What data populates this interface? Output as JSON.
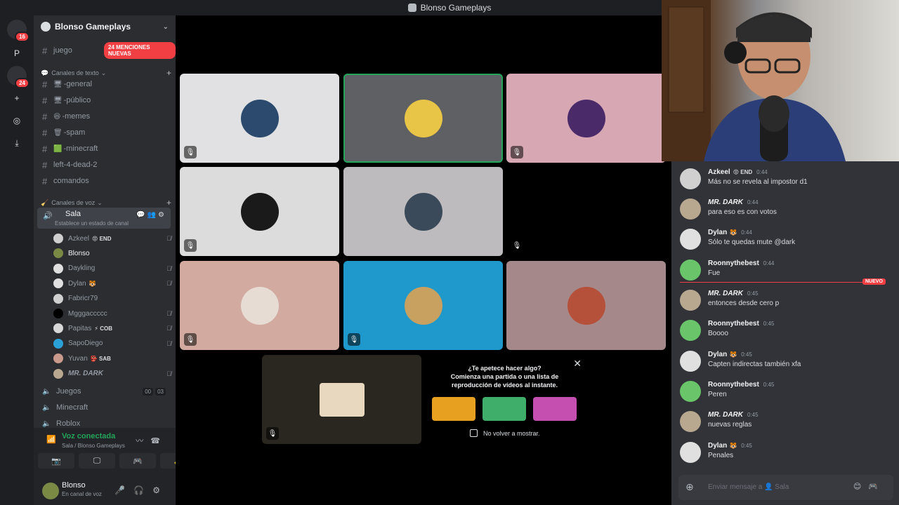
{
  "window": {
    "title": "Blonso Gameplays"
  },
  "rail": {
    "items": [
      {
        "label": "",
        "badge": "16",
        "icon": "discord-home-icon"
      },
      {
        "label": "P",
        "badge": "",
        "icon": ""
      },
      {
        "label": "",
        "badge": "24",
        "icon": "server-avatar"
      },
      {
        "label": "+",
        "badge": "",
        "icon": "add-server-icon"
      },
      {
        "label": "◎",
        "badge": "",
        "icon": "explore-icon"
      },
      {
        "label": "⤓",
        "badge": "",
        "icon": "download-icon"
      }
    ]
  },
  "server": {
    "name": "Blonso Gameplays"
  },
  "mentions_pill": "24 MENCIONES NUEVAS",
  "partial_channel": "juego",
  "text_category": "Canales de texto",
  "text_channels": [
    {
      "emoji": "🖥",
      "name": "-general"
    },
    {
      "emoji": "🖥",
      "name": "-público"
    },
    {
      "emoji": "😆",
      "name": "-memes"
    },
    {
      "emoji": "🗑",
      "name": "-spam"
    },
    {
      "emoji": "🟩",
      "name": "-minecraft"
    },
    {
      "emoji": "",
      "name": "left-4-dead-2"
    },
    {
      "emoji": "",
      "name": "comandos"
    }
  ],
  "voice_category": "Canales de voz",
  "active_voice": {
    "name": "Sala",
    "status": "Establece un estado de canal"
  },
  "voice_users": [
    {
      "name": "Azkeel",
      "tag": "😡 END",
      "muted": true,
      "color": "#cfcfcf"
    },
    {
      "name": "Blonso",
      "tag": "",
      "muted": false,
      "color": "#7a8a45"
    },
    {
      "name": "Daykling",
      "tag": "",
      "muted": true,
      "color": "#e0e0e0"
    },
    {
      "name": "Dylan",
      "tag": "🐯",
      "muted": true,
      "color": "#e0e0e0"
    },
    {
      "name": "Fabricr79",
      "tag": "",
      "muted": false,
      "color": "#d0d0d0"
    },
    {
      "name": "Mgggaccccc",
      "tag": "",
      "muted": true,
      "color": "#000000"
    },
    {
      "name": "Papitas",
      "tag": "⚡ COB",
      "muted": true,
      "color": "#d8d8d8"
    },
    {
      "name": "SapoDiego",
      "tag": "",
      "muted": true,
      "color": "#2aa1d6"
    },
    {
      "name": "Yuvan",
      "tag": "👺 SAB",
      "muted": false,
      "color": "#c99a8c"
    },
    {
      "name": "MR. DARK",
      "tag": "",
      "muted": true,
      "color": "#b8a890"
    }
  ],
  "other_voice": [
    {
      "name": "Juegos",
      "count1": "00",
      "count2": "03"
    },
    {
      "name": "Minecraft",
      "count1": "",
      "count2": ""
    },
    {
      "name": "Roblox",
      "count1": "",
      "count2": ""
    }
  ],
  "voice_panel": {
    "title": "Voz conectada",
    "subtitle": "Sala / Blonso Gameplays"
  },
  "user_panel": {
    "name": "Blonso",
    "status": "En canal de voz"
  },
  "tiles": [
    {
      "bg": "#e1e1e3",
      "avatar": "#2b4a6e",
      "muted": true,
      "highlighted": false
    },
    {
      "bg": "#5e6064",
      "avatar": "#e8c447",
      "muted": false,
      "highlighted": true
    },
    {
      "bg": "#d7a8b4",
      "avatar": "#4b2a6a",
      "muted": true,
      "highlighted": false
    },
    {
      "bg": "#dcdcdc",
      "avatar": "#1a1a1a",
      "muted": true,
      "highlighted": false
    },
    {
      "bg": "#bdbbbd",
      "avatar": "#3a4a5a",
      "muted": false,
      "highlighted": false
    },
    {
      "bg": "#000000",
      "avatar": "#000000",
      "muted": true,
      "highlighted": false
    },
    {
      "bg": "#d2aaa0",
      "avatar": "#e6dcd4",
      "muted": true,
      "highlighted": false
    },
    {
      "bg": "#1f99cc",
      "avatar": "#c8a060",
      "muted": true,
      "highlighted": false
    },
    {
      "bg": "#a5898a",
      "avatar": "#b5503a",
      "muted": false,
      "highlighted": false
    },
    {
      "bg": "#2a2720",
      "avatar": "#e8d8c0",
      "muted": true,
      "highlighted": false
    }
  ],
  "activity": {
    "title": "¿Te apetece hacer algo?",
    "subtitle": "Comienza una partida o una lista de reproducción de vídeos al instante.",
    "games": [
      "#e7a020",
      "#3fae6a",
      "#c44fb0"
    ],
    "checkbox_label": "No volver a mostrar."
  },
  "chat": {
    "messages": [
      {
        "author": "Azkeel",
        "badge": "😡 END",
        "time": "0:44",
        "text": "Más no se revela al impostor d1",
        "avatar": "#d0d0d0"
      },
      {
        "author": "MR. DARK",
        "badge": "",
        "time": "0:44",
        "text": "para eso es con votos",
        "avatar": "#b8a890"
      },
      {
        "author": "Dylan",
        "badge": "🐯",
        "time": "0:44",
        "text": "Sólo te quedas mute @dark",
        "avatar": "#e0e0e0"
      },
      {
        "author": "Roonnythebest",
        "badge": "",
        "time": "0:44",
        "text": "Fue",
        "avatar": "#6ac46a"
      },
      {
        "author": "MR. DARK",
        "badge": "",
        "time": "0:45",
        "text": "entonces desde cero p",
        "avatar": "#b8a890"
      },
      {
        "author": "Roonnythebest",
        "badge": "",
        "time": "0:45",
        "text": "Boooo",
        "avatar": "#6ac46a"
      },
      {
        "author": "Dylan",
        "badge": "🐯",
        "time": "0:45",
        "text": "Capten indirectas también xfa",
        "avatar": "#e0e0e0"
      },
      {
        "author": "Roonnythebest",
        "badge": "",
        "time": "0:45",
        "text": "Peren",
        "avatar": "#6ac46a"
      },
      {
        "author": "MR. DARK",
        "badge": "",
        "time": "0:45",
        "text": "nuevas reglas",
        "avatar": "#b8a890"
      },
      {
        "author": "Dylan",
        "badge": "🐯",
        "time": "0:45",
        "text": "Penales",
        "avatar": "#e0e0e0"
      }
    ],
    "new_label": "NUEVO",
    "placeholder": "Enviar mensaje a 👤 Sala"
  }
}
